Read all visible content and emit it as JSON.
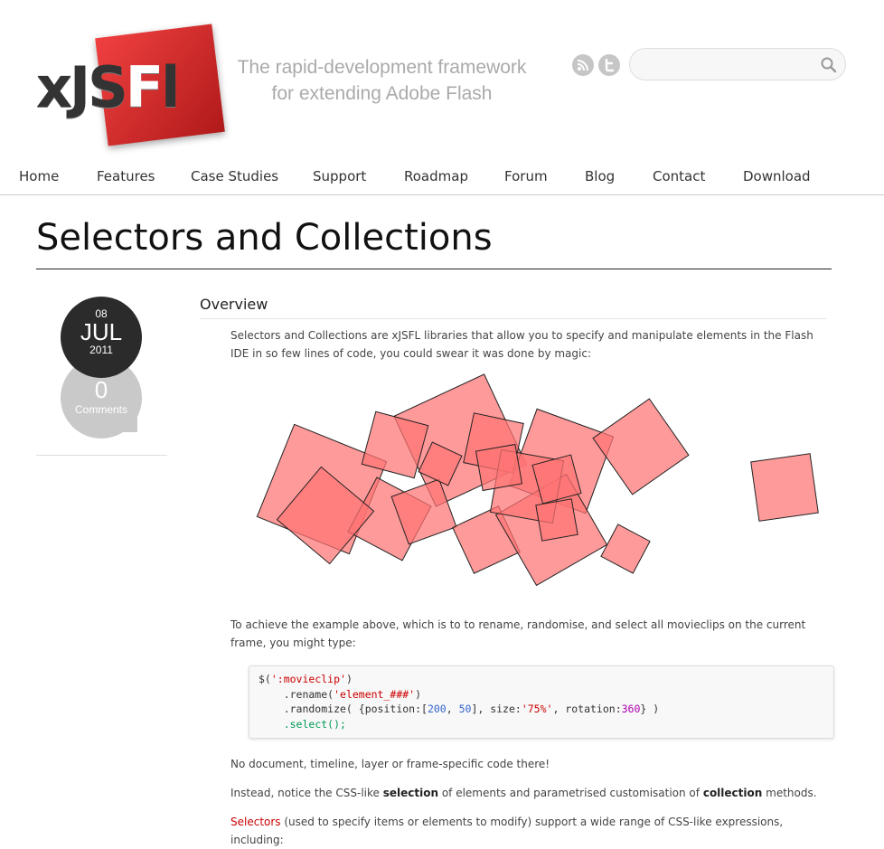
{
  "logo": {
    "text_dark1": "x",
    "text_dark2": "JS",
    "text_white": "F",
    "text_dark3": "l"
  },
  "tagline": {
    "line1": "The rapid-development framework",
    "line2": "for extending Adobe Flash"
  },
  "search": {
    "placeholder": ""
  },
  "nav": {
    "items": [
      "Home",
      "Features",
      "Case Studies",
      "Support",
      "Roadmap",
      "Forum",
      "Blog",
      "Contact",
      "Download"
    ]
  },
  "page": {
    "title": "Selectors and Collections"
  },
  "date": {
    "day": "08",
    "month": "JUL",
    "year": "2011",
    "comments_count": "0",
    "comments_label": "Comments"
  },
  "content": {
    "heading": "Overview",
    "intro": "Selectors and Collections are xJSFL libraries that allow you to specify and manipulate elements in the Flash IDE in so few lines of code, you could swear it was done by magic:",
    "example_intro": "To achieve the example above, which is to to rename, randomise, and select all movieclips on the current frame, you might type:",
    "code": {
      "l1a": "$(",
      "l1b": "':movieclip'",
      "l1c": ")",
      "l2a": "    .rename(",
      "l2b": "'element_###'",
      "l2c": ")",
      "l3a": "    .randomize( {position:[",
      "l3b": "200",
      "l3c": ", ",
      "l3d": "50",
      "l3e": "], size:",
      "l3f": "'75%'",
      "l3g": ", rotation:",
      "l3h": "360",
      "l3i": "} )",
      "l4a": "    ",
      "l4b": ".select",
      "l4c": "();"
    },
    "note1": "No document, timeline, layer or frame-specific code there!",
    "note2_a": "Instead, notice the CSS-like ",
    "note2_b": "selection",
    "note2_c": " of elements and parametrised customisation of ",
    "note2_d": "collection",
    "note2_e": " methods.",
    "note3_a": "Selectors",
    "note3_b": " (used to specify items or elements to modify) support a wide range of CSS-like expressions, including:"
  },
  "colors": {
    "accent": "#d62828",
    "square_fill": "#ff8a8a"
  }
}
